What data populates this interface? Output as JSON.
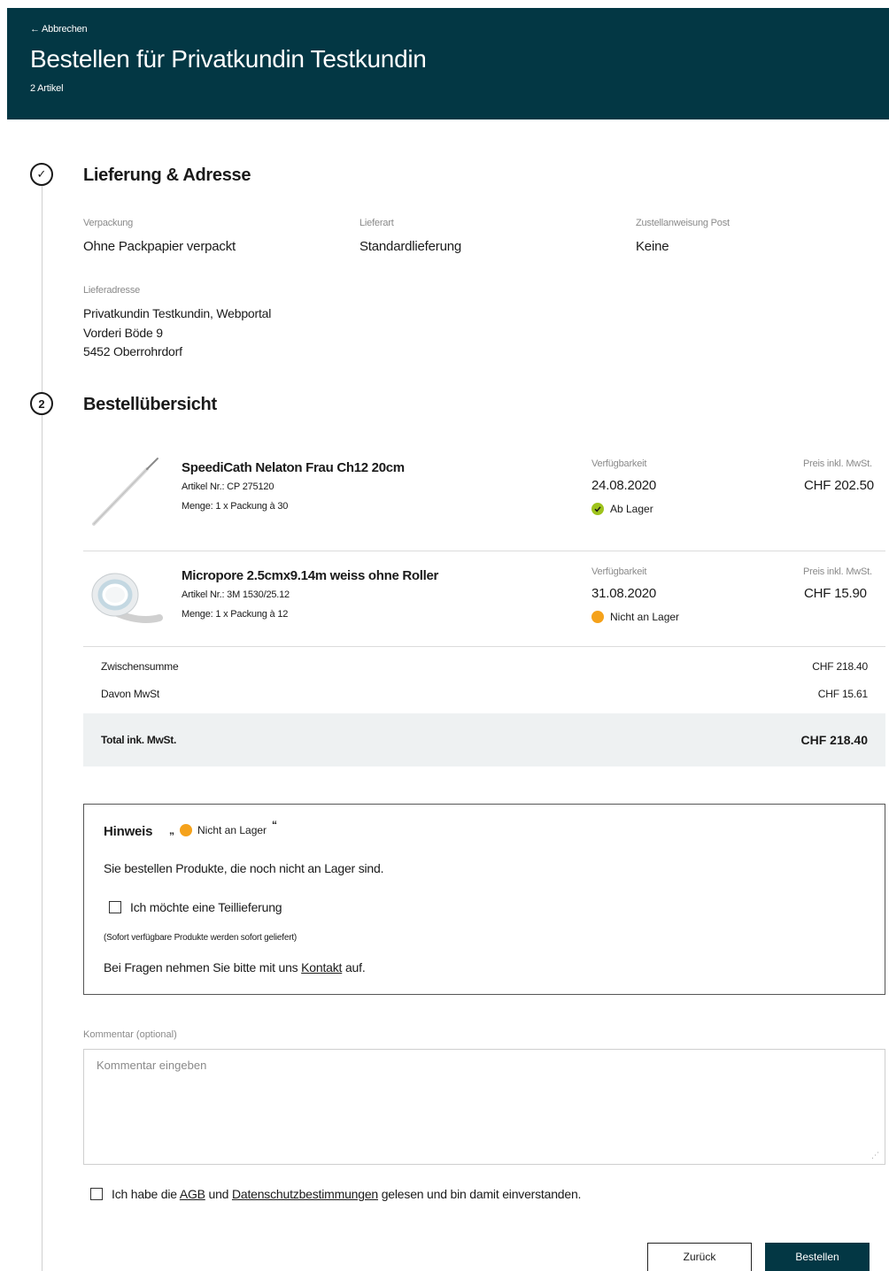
{
  "header": {
    "back_label": "← Abbrechen",
    "title": "Bestellen für Privatkundin Testkundin",
    "item_count": "2 Artikel"
  },
  "steps": {
    "step1_icon": "✓",
    "step2_number": "2"
  },
  "delivery": {
    "section_title": "Lieferung & Adresse",
    "packaging_label": "Verpackung",
    "packaging_value": "Ohne Packpapier verpackt",
    "delivery_type_label": "Lieferart",
    "delivery_type_value": "Standardlieferung",
    "post_instruction_label": "Zustellanweisung Post",
    "post_instruction_value": "Keine",
    "address_label": "Lieferadresse",
    "address_lines": [
      "Privatkundin Testkundin, Webportal",
      "Vorderi Böde 9",
      "5452 Oberrohrdorf"
    ]
  },
  "overview": {
    "section_title": "Bestellübersicht",
    "availability_label": "Verfügbarkeit",
    "price_label": "Preis inkl. MwSt.",
    "products": [
      {
        "name": "SpeediCath Nelaton Frau Ch12 20cm",
        "article_no": "Artikel Nr.: CP 275120",
        "quantity": "Menge: 1 x Packung à 30",
        "availability_date": "24.08.2020",
        "stock_status": "Ab Lager",
        "stock_color": "#9ec31c",
        "price": "CHF 202.50",
        "image_icon": "catheter-image"
      },
      {
        "name": "Micropore 2.5cmx9.14m weiss ohne Roller",
        "article_no": "Artikel Nr.: 3M 1530/25.12",
        "quantity": "Menge: 1 x Packung à 12",
        "availability_date": "31.08.2020",
        "stock_status": "Nicht an Lager",
        "stock_color": "#f5a21b",
        "price": "CHF 15.90",
        "image_icon": "tape-roll-image"
      }
    ],
    "subtotal_label": "Zwischensumme",
    "subtotal_value": "CHF 218.40",
    "vat_label": "Davon MwSt",
    "vat_value": "CHF 15.61",
    "total_label": "Total ink. MwSt.",
    "total_value": "CHF 218.40"
  },
  "notice": {
    "title": "Hinweis",
    "quote_open": "„",
    "badge_text": "Nicht an Lager",
    "quote_close": "“",
    "text": "Sie bestellen Produkte, die noch nicht an Lager sind.",
    "partial_delivery_label": "Ich möchte eine Teillieferung",
    "partial_delivery_hint": "(Sofort verfügbare Produkte werden sofort geliefert)",
    "contact_prefix": "Bei Fragen nehmen Sie bitte mit uns",
    "contact_link": "Kontakt",
    "contact_suffix": "auf."
  },
  "comment": {
    "label": "Kommentar (optional)",
    "placeholder": "Kommentar eingeben",
    "value": ""
  },
  "terms": {
    "prefix": "Ich habe die",
    "agb_link": "AGB",
    "middle": "und",
    "privacy_link": "Datenschutzbestimmungen",
    "suffix": "gelesen und bin damit einverstanden."
  },
  "actions": {
    "back_label": "Zurück",
    "order_label": "Bestellen"
  },
  "colors": {
    "brand": "#033744",
    "in_stock": "#9ec31c",
    "out_of_stock": "#f5a21b"
  }
}
